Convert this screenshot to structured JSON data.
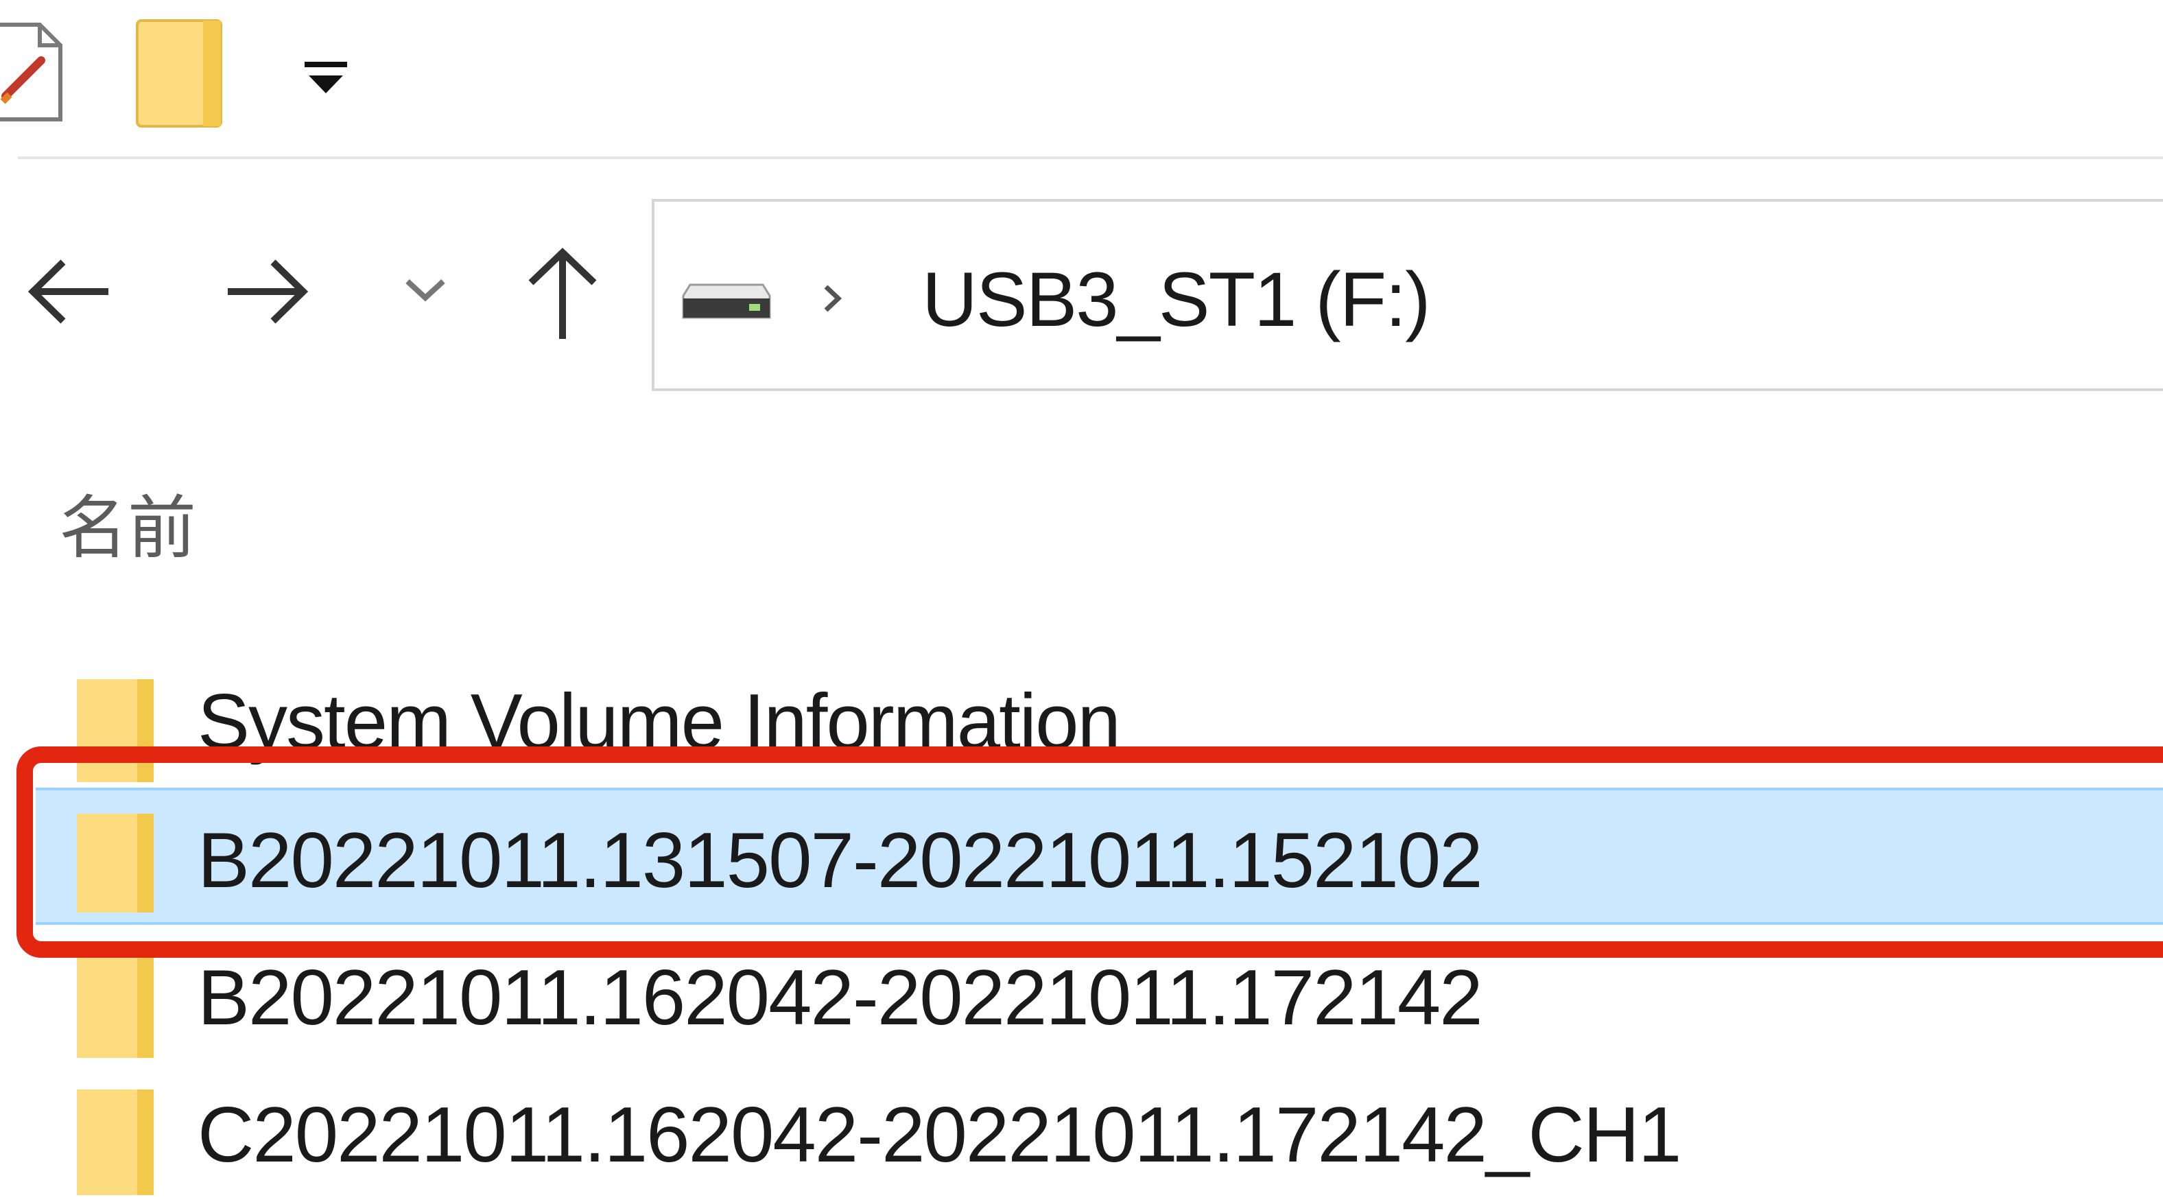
{
  "quick_access_toolbar": {
    "icons": [
      "properties-icon",
      "new-folder-icon",
      "customize-dropdown-icon"
    ]
  },
  "navigation": {
    "back_icon": "arrow-left-icon",
    "forward_icon": "arrow-right-icon",
    "recent_icon": "chevron-down-icon",
    "up_icon": "arrow-up-icon"
  },
  "address_bar": {
    "drive_icon": "usb-drive-icon",
    "separator": "›",
    "location": "USB3_ST1 (F:)"
  },
  "file_list": {
    "column_header": "名前",
    "items": [
      {
        "name": "System Volume Information",
        "icon": "folder-icon",
        "selected": false
      },
      {
        "name": "B20221011.131507-20221011.152102",
        "icon": "folder-icon",
        "selected": true
      },
      {
        "name": "B20221011.162042-20221011.172142",
        "icon": "folder-icon",
        "selected": false
      },
      {
        "name": "C20221011.162042-20221011.172142_CH1",
        "icon": "folder-icon",
        "selected": false
      }
    ]
  },
  "colors": {
    "selection_fill": "#cce8ff",
    "selection_border": "#99d1ff",
    "annotation_box": "#e2260f",
    "folder_fill": "#fcdc7e"
  }
}
